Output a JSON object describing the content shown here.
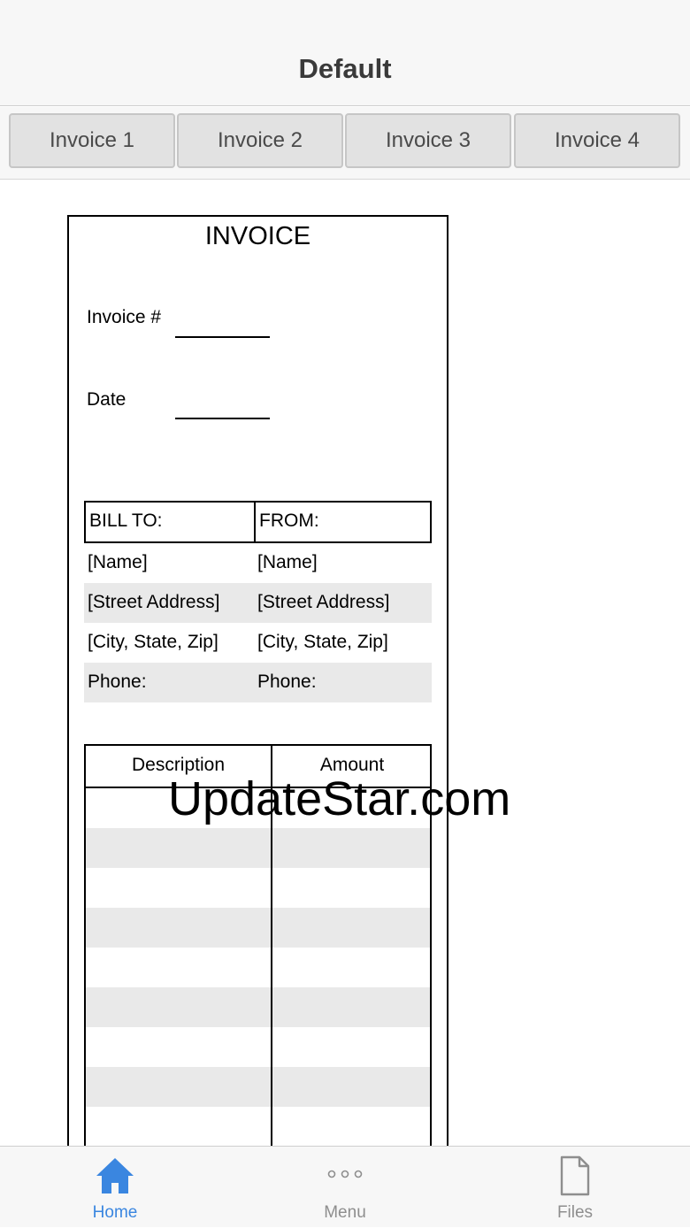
{
  "header": {
    "title": "Default"
  },
  "tabs": [
    {
      "label": "Invoice 1"
    },
    {
      "label": "Invoice 2"
    },
    {
      "label": "Invoice 3"
    },
    {
      "label": "Invoice 4"
    }
  ],
  "invoice": {
    "title": "INVOICE",
    "invoice_number_label": "Invoice #",
    "date_label": "Date",
    "bill_to_label": "BILL TO:",
    "from_label": "FROM:",
    "bill_to": {
      "name": "[Name]",
      "street": "[Street Address]",
      "city": "[City, State, Zip]",
      "phone": "Phone:"
    },
    "from": {
      "name": "[Name]",
      "street": "[Street Address]",
      "city": "[City, State, Zip]",
      "phone": "Phone:"
    },
    "columns": {
      "description": "Description",
      "amount": "Amount"
    }
  },
  "watermark": "UpdateStar.com",
  "bottom_nav": {
    "home": "Home",
    "menu": "Menu",
    "files": "Files"
  },
  "colors": {
    "accent": "#3a86e0",
    "inactive": "#8e8e8e",
    "row_shade": "#e9e9e9"
  }
}
